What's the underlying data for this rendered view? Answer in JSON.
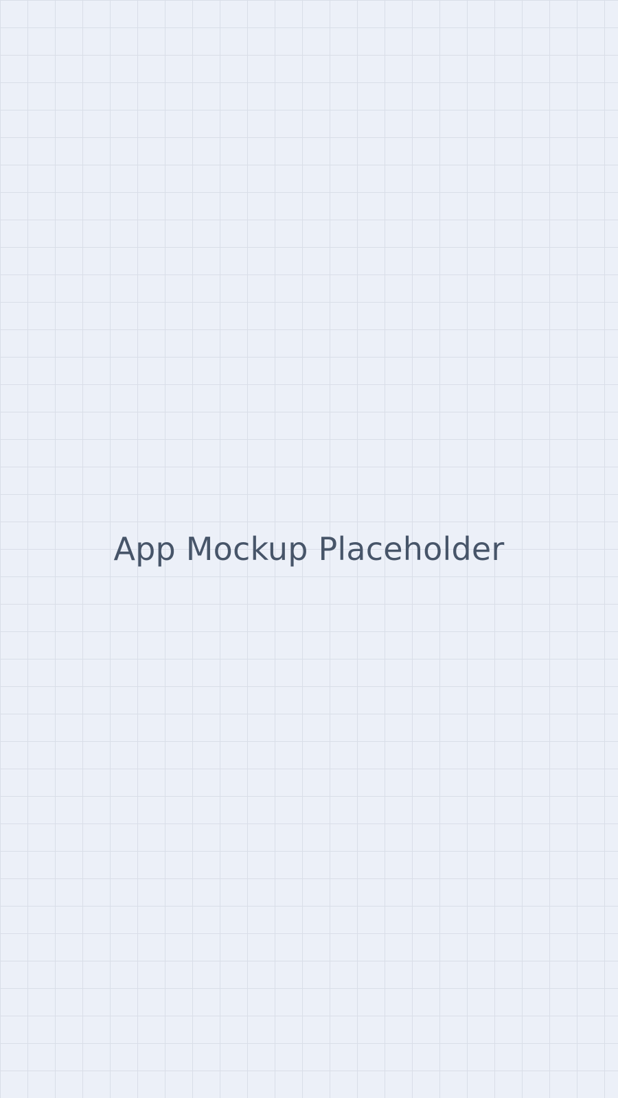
{
  "placeholder": {
    "label": "App Mockup Placeholder"
  },
  "colors": {
    "background": "#ecf0f8",
    "grid_line": "#d9dee8",
    "text": "#475569"
  }
}
